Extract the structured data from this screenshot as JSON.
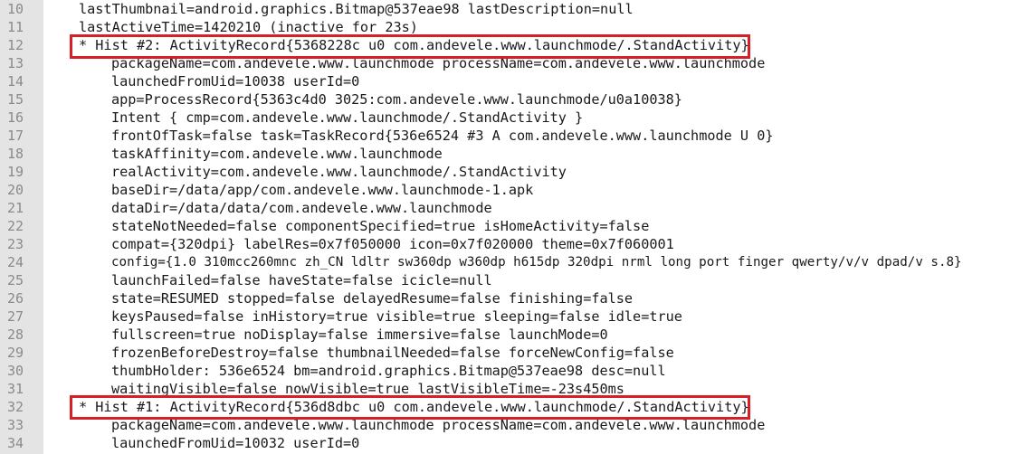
{
  "highlight_color": "#d61f26",
  "lines": [
    {
      "number": "10",
      "text": "lastThumbnail=android.graphics.Bitmap@537eae98 lastDescription=null"
    },
    {
      "number": "11",
      "text": "lastActiveTime=1420210 (inactive for 23s)"
    },
    {
      "number": "12",
      "text": "* Hist #2: ActivityRecord{5368228c u0 com.andevele.www.launchmode/.StandActivity}"
    },
    {
      "number": "13",
      "text": "packageName=com.andevele.www.launchmode processName=com.andevele.www.launchmode"
    },
    {
      "number": "14",
      "text": "launchedFromUid=10038 userId=0"
    },
    {
      "number": "15",
      "text": "app=ProcessRecord{5363c4d0 3025:com.andevele.www.launchmode/u0a10038}"
    },
    {
      "number": "16",
      "text": "Intent { cmp=com.andevele.www.launchmode/.StandActivity }"
    },
    {
      "number": "17",
      "text": "frontOfTask=false task=TaskRecord{536e6524 #3 A com.andevele.www.launchmode U 0}"
    },
    {
      "number": "18",
      "text": "taskAffinity=com.andevele.www.launchmode"
    },
    {
      "number": "19",
      "text": "realActivity=com.andevele.www.launchmode/.StandActivity"
    },
    {
      "number": "20",
      "text": "baseDir=/data/app/com.andevele.www.launchmode-1.apk"
    },
    {
      "number": "21",
      "text": "dataDir=/data/data/com.andevele.www.launchmode"
    },
    {
      "number": "22",
      "text": "stateNotNeeded=false componentSpecified=true isHomeActivity=false"
    },
    {
      "number": "23",
      "text": "compat={320dpi} labelRes=0x7f050000 icon=0x7f020000 theme=0x7f060001"
    },
    {
      "number": "24",
      "text": "config={1.0 310mcc260mnc zh_CN ldltr sw360dp w360dp h615dp 320dpi nrml long port finger qwerty/v/v dpad/v s.8}"
    },
    {
      "number": "25",
      "text": "launchFailed=false haveState=false icicle=null"
    },
    {
      "number": "26",
      "text": "state=RESUMED stopped=false delayedResume=false finishing=false"
    },
    {
      "number": "27",
      "text": "keysPaused=false inHistory=true visible=true sleeping=false idle=true"
    },
    {
      "number": "28",
      "text": "fullscreen=true noDisplay=false immersive=false launchMode=0"
    },
    {
      "number": "29",
      "text": "frozenBeforeDestroy=false thumbnailNeeded=false forceNewConfig=false"
    },
    {
      "number": "30",
      "text": "thumbHolder: 536e6524 bm=android.graphics.Bitmap@537eae98 desc=null"
    },
    {
      "number": "31",
      "text": "waitingVisible=false nowVisible=true lastVisibleTime=-23s450ms"
    },
    {
      "number": "32",
      "text": "* Hist #1: ActivityRecord{536d8dbc u0 com.andevele.www.launchmode/.StandActivity}"
    },
    {
      "number": "33",
      "text": "packageName=com.andevele.www.launchmode processName=com.andevele.www.launchmode"
    },
    {
      "number": "34",
      "text": "launchedFromUid=10032 userId=0"
    }
  ]
}
